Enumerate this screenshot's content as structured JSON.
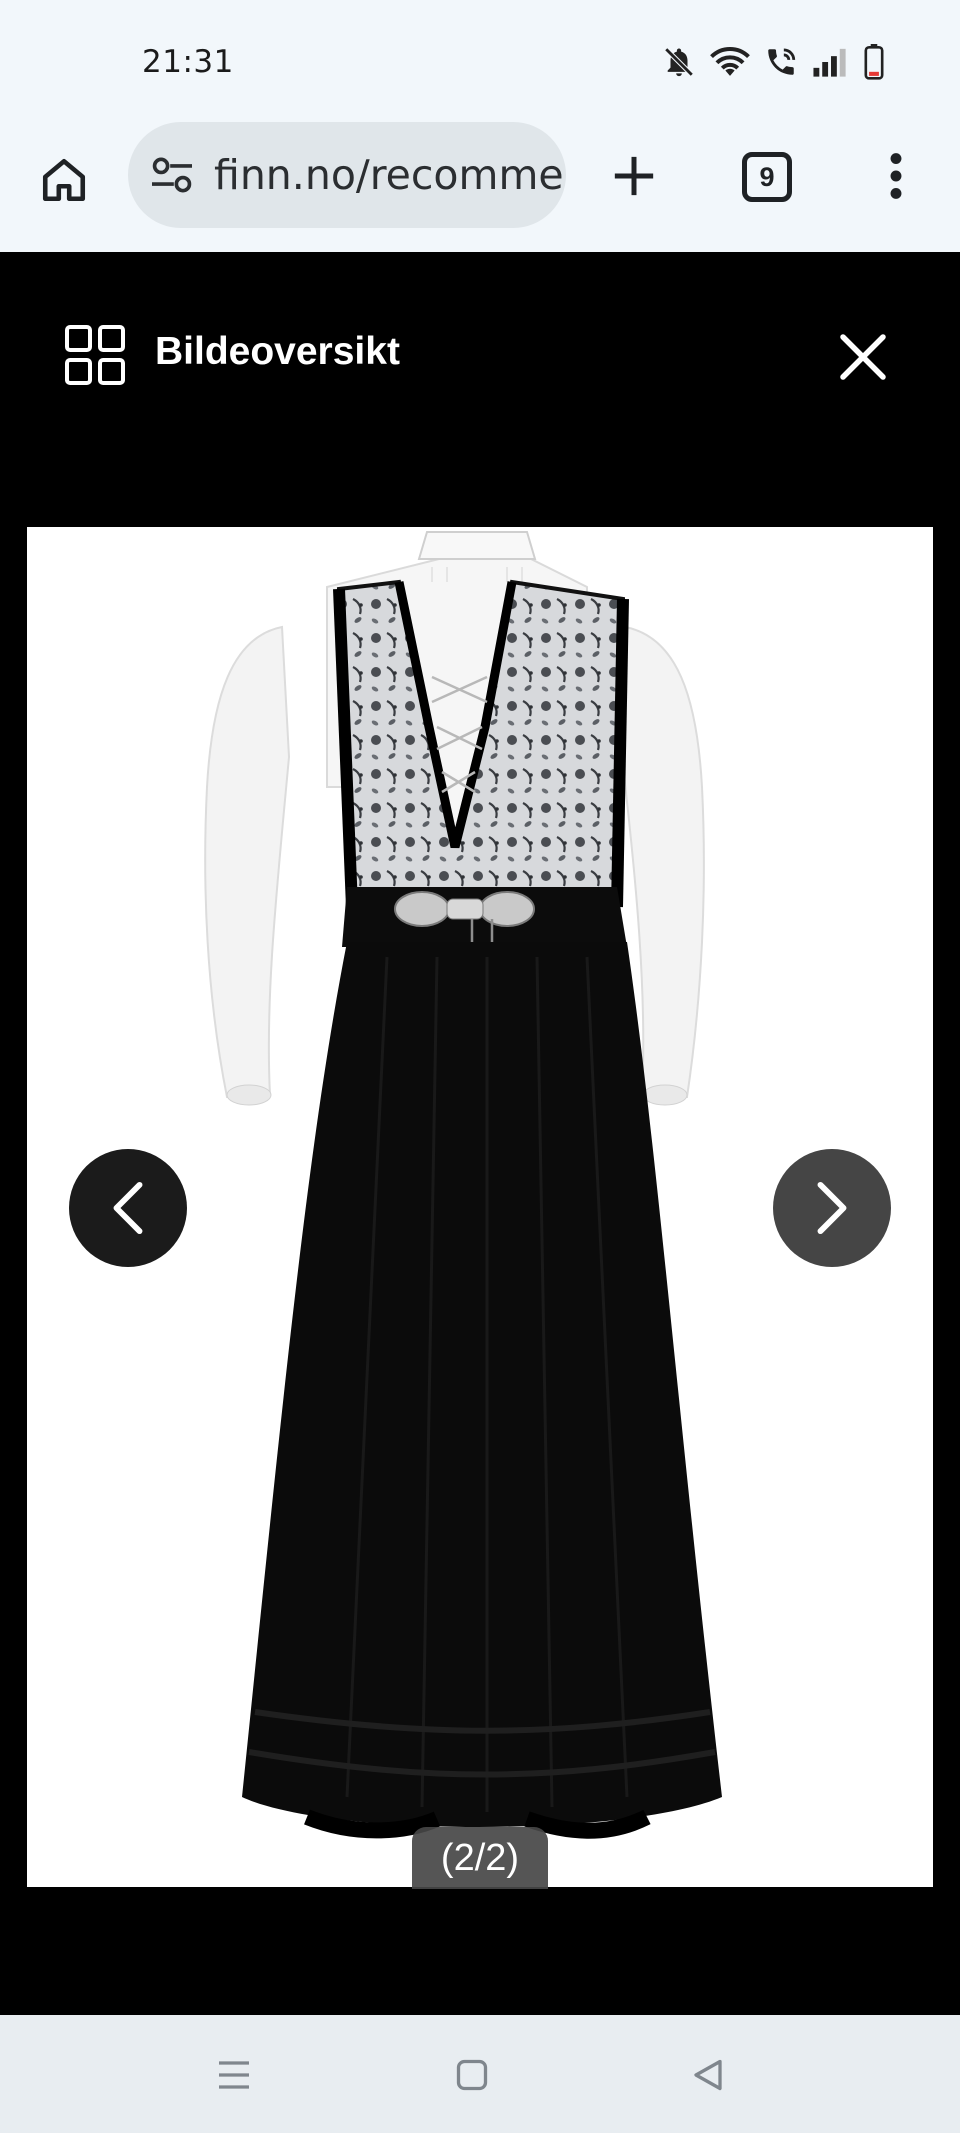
{
  "status_bar": {
    "time": "21:31",
    "icons": [
      "bell-muted-icon",
      "wifi-icon",
      "wifi-calling-icon",
      "signal-icon",
      "battery-low-icon"
    ]
  },
  "browser": {
    "url": "finn.no/recomme",
    "tab_count": "9",
    "icons": [
      "home-icon",
      "site-settings-icon",
      "new-tab-icon",
      "tab-switcher-icon",
      "more-menu-icon"
    ]
  },
  "viewer": {
    "title": "Bildeoversikt",
    "counter": "(2/2)",
    "icons": [
      "grid-overview-icon",
      "close-icon",
      "chevron-left-icon",
      "chevron-right-icon"
    ],
    "image_subject": "bunad"
  },
  "system_nav": {
    "icons": [
      "recents-icon",
      "home-square-icon",
      "back-triangle-icon"
    ]
  },
  "colors": {
    "page_bg": "#000000",
    "chrome_bg": "#f2f7fb",
    "url_pill_bg": "#e0e6ea",
    "nav_bar_bg": "#e8edf1"
  }
}
